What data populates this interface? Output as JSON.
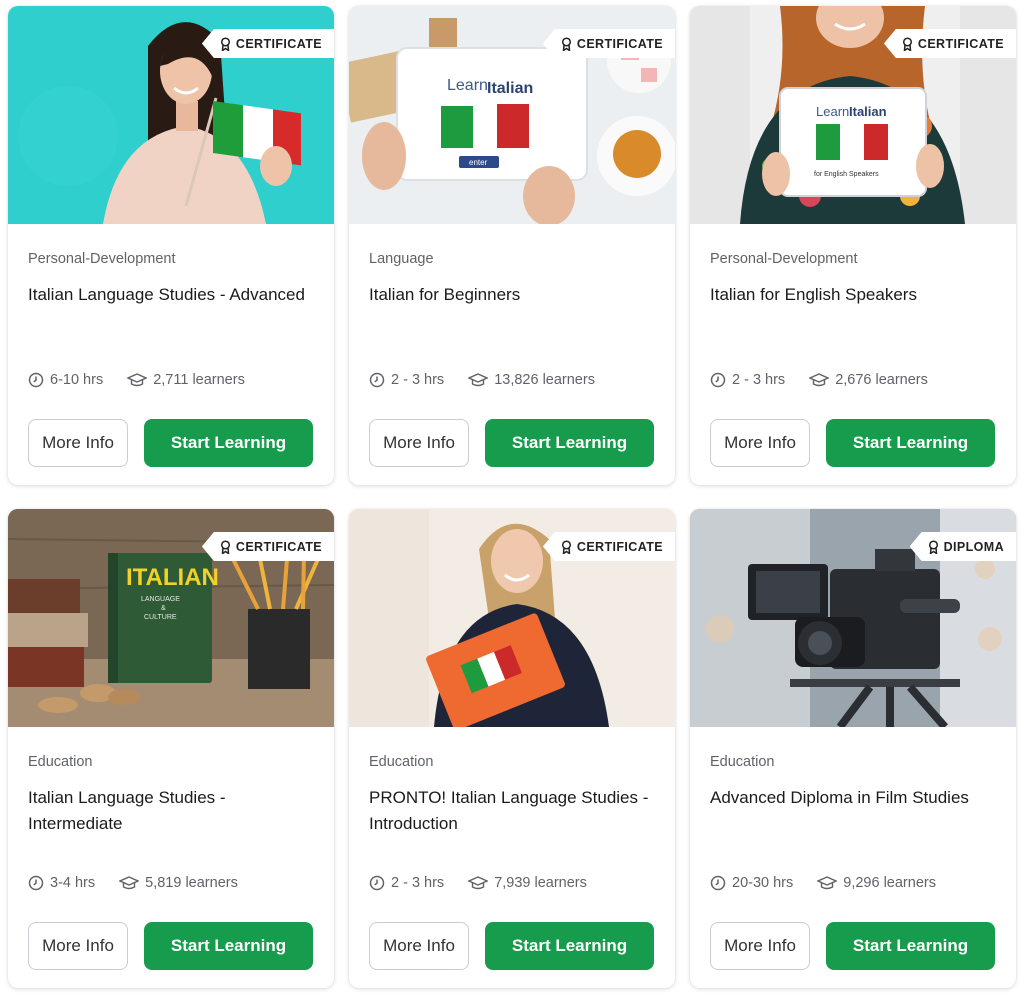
{
  "colors": {
    "accent": "#179b4c",
    "badge_bg": "#ffffff",
    "muted": "#5f6368"
  },
  "courses": [
    {
      "badge": "CERTIFICATE",
      "category": "Personal-Development",
      "title": "Italian Language Studies - Advanced",
      "duration": "6-10 hrs",
      "learners": "2,711 learners",
      "more_label": "More Info",
      "start_label": "Start Learning"
    },
    {
      "badge": "CERTIFICATE",
      "category": "Language",
      "title": "Italian for Beginners",
      "duration": "2 - 3 hrs",
      "learners": "13,826 learners",
      "more_label": "More Info",
      "start_label": "Start Learning",
      "image_text": {
        "line1": "Learn",
        "line2": "Italian",
        "button": "enter"
      }
    },
    {
      "badge": "CERTIFICATE",
      "category": "Personal-Development",
      "title": "Italian for English Speakers",
      "duration": "2 - 3 hrs",
      "learners": "2,676 learners",
      "more_label": "More Info",
      "start_label": "Start Learning",
      "image_text": {
        "line1": "Learn",
        "line2": "Italian",
        "sub": "for English Speakers"
      }
    },
    {
      "badge": "CERTIFICATE",
      "category": "Education",
      "title": "Italian Language Studies - Intermediate",
      "duration": "3-4 hrs",
      "learners": "5,819 learners",
      "more_label": "More Info",
      "start_label": "Start Learning",
      "image_text": {
        "book": "ITALIAN",
        "book_sub1": "LANGUAGE",
        "book_sub2": "&",
        "book_sub3": "CULTURE"
      }
    },
    {
      "badge": "CERTIFICATE",
      "category": "Education",
      "title": "PRONTO! Italian Language Studies - Introduction",
      "duration": "2 - 3 hrs",
      "learners": "7,939 learners",
      "more_label": "More Info",
      "start_label": "Start Learning"
    },
    {
      "badge": "DIPLOMA",
      "category": "Education",
      "title": "Advanced Diploma in Film Studies",
      "duration": "20-30 hrs",
      "learners": "9,296 learners",
      "more_label": "More Info",
      "start_label": "Start Learning"
    }
  ]
}
